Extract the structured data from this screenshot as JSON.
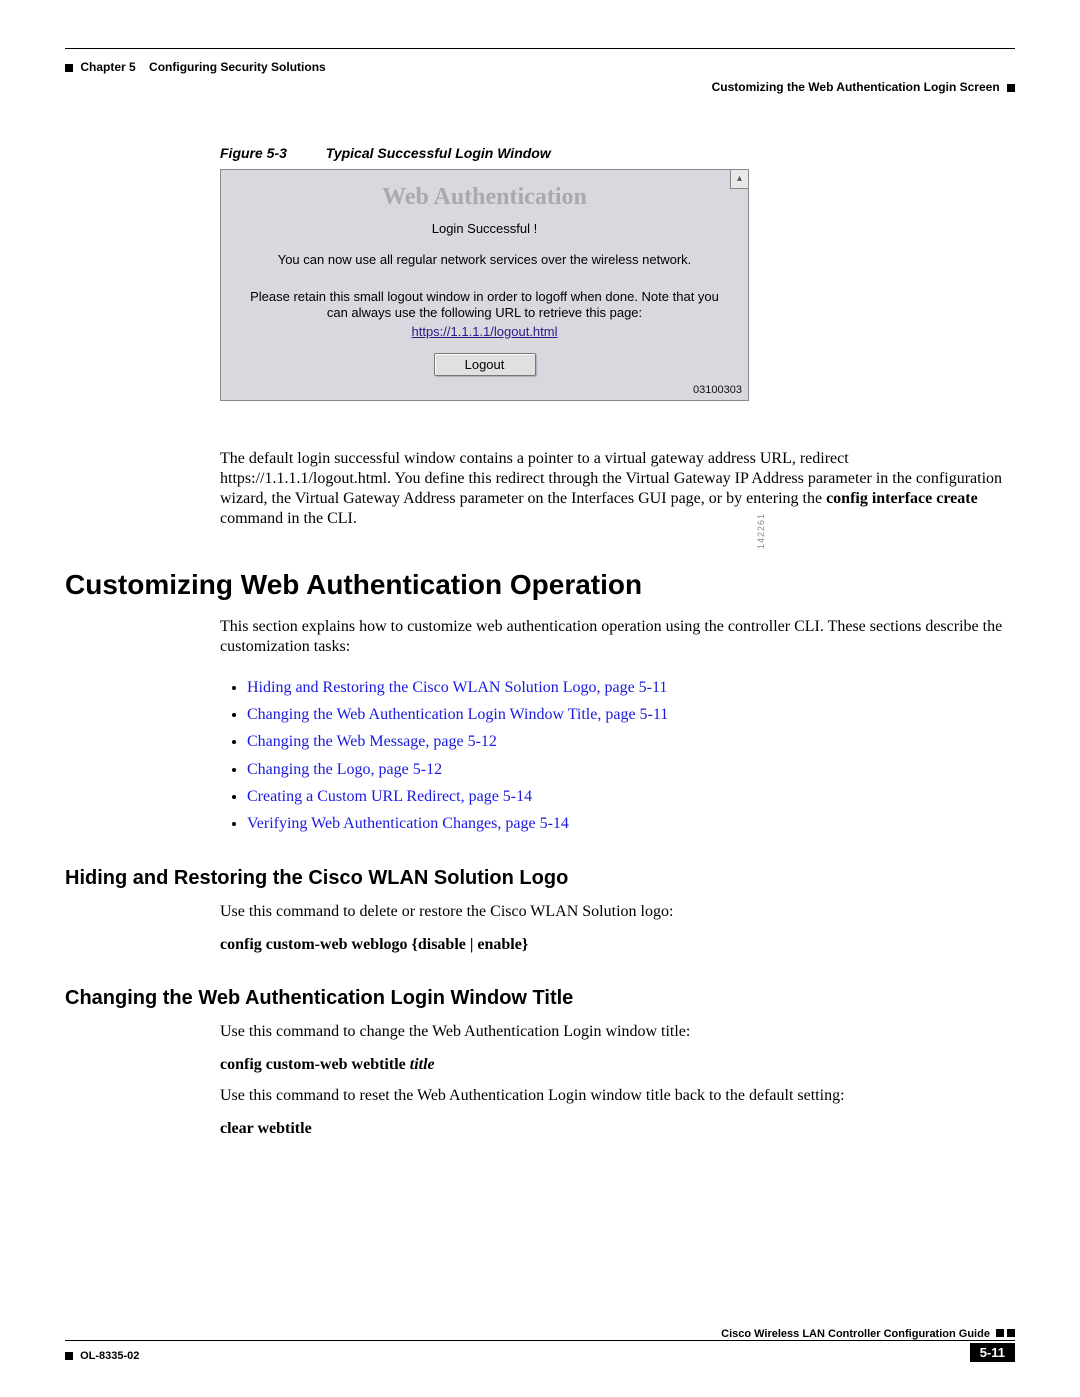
{
  "header": {
    "chapter": "Chapter 5",
    "chapter_title": "Configuring Security Solutions",
    "section": "Customizing the Web Authentication Login Screen"
  },
  "figure": {
    "label": "Figure 5-3",
    "caption": "Typical Successful Login Window",
    "window_title": "Web Authentication",
    "login_success": "Login Successful !",
    "msg1": "You can now use all regular network services over the wireless network.",
    "msg2": "Please retain this small logout window in order to logoff when done. Note that you can always use the following URL to retrieve this page:",
    "url": "https://1.1.1.1/logout.html",
    "button": "Logout",
    "stamp": "03100303",
    "sidecode": "142261",
    "scroll_glyph": "▴"
  },
  "para1_a": "The default login successful window contains a pointer to a virtual gateway address URL, redirect https://1.1.1.1/logout.html. You define this redirect through the Virtual Gateway IP Address parameter in the configuration wizard, the Virtual Gateway Address parameter on the Interfaces GUI page, or by entering the ",
  "para1_b": "config interface create",
  "para1_c": " command in the CLI.",
  "h2": "Customizing Web Authentication Operation",
  "intro": "This section explains how to customize web authentication operation using the controller CLI. These sections describe the customization tasks:",
  "links": [
    "Hiding and Restoring the Cisco WLAN Solution Logo, page 5-11",
    "Changing the Web Authentication Login Window Title, page 5-11",
    "Changing the Web Message, page 5-12",
    "Changing the Logo, page 5-12",
    "Creating a Custom URL Redirect, page 5-14",
    "Verifying Web Authentication Changes, page 5-14"
  ],
  "sub1": {
    "title": "Hiding and Restoring the Cisco WLAN Solution Logo",
    "desc": "Use this command to delete or restore the Cisco WLAN Solution logo:",
    "cmd": "config custom-web weblogo {disable | enable}"
  },
  "sub2": {
    "title": "Changing the Web Authentication Login Window Title",
    "desc1": "Use this command to change the Web Authentication Login window title:",
    "cmd1_a": "config custom-web webtitle ",
    "cmd1_b": "title",
    "desc2": "Use this command to reset the Web Authentication Login window title back to the default setting:",
    "cmd2": "clear webtitle"
  },
  "footer": {
    "guide": "Cisco Wireless LAN Controller Configuration Guide",
    "doc": "OL-8335-02",
    "page": "5-11"
  }
}
